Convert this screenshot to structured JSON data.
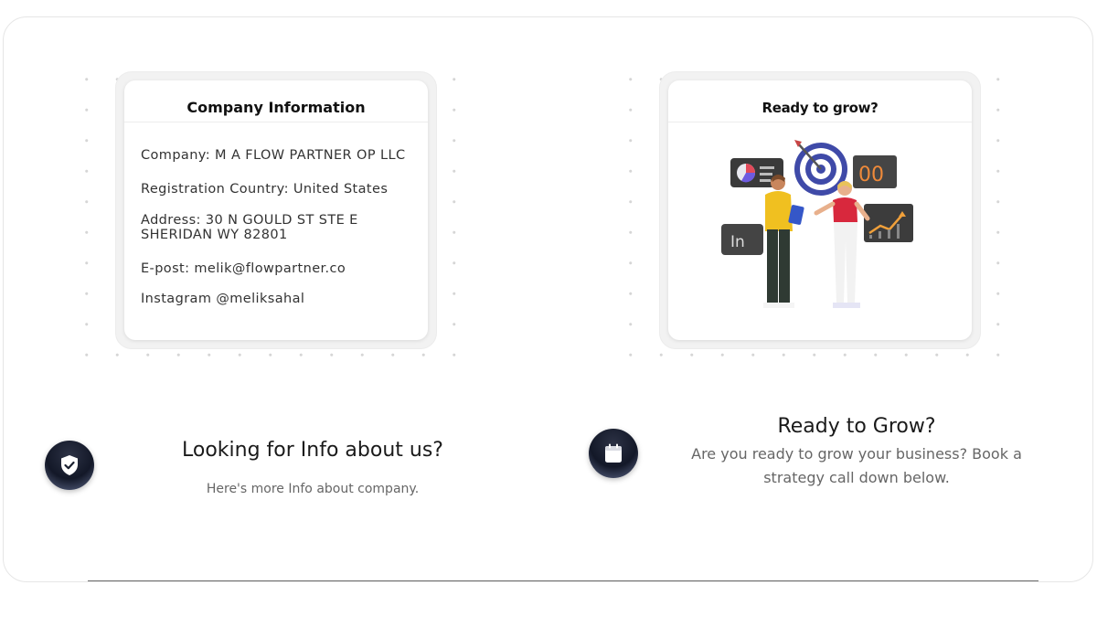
{
  "company_card": {
    "title": "Company Information",
    "company": "Company: M A FLOW PARTNER OP LLC",
    "registration": "Registration Country: United States",
    "address_line1": "Address: 30 N GOULD ST STE E",
    "address_line2": "SHERIDAN WY 82801",
    "email": "E-post: melik@flowpartner.co",
    "instagram": "Instagram @meliksahal"
  },
  "grow_card": {
    "title": "Ready to grow?",
    "illustration_labels": {
      "in": "In",
      "oo": "00"
    }
  },
  "info_section": {
    "icon": "shield-check-icon",
    "heading": "Looking for Info about us?",
    "subtext": "Here's more Info about company."
  },
  "grow_section": {
    "icon": "calendar-icon",
    "heading": "Ready to Grow?",
    "subtext": "Are you ready to grow your business? Book a strategy call down below."
  },
  "colors": {
    "icon_circle": "#131828",
    "heading": "#1a1a1a",
    "subtext": "#666666",
    "card_border": "#ececec"
  }
}
